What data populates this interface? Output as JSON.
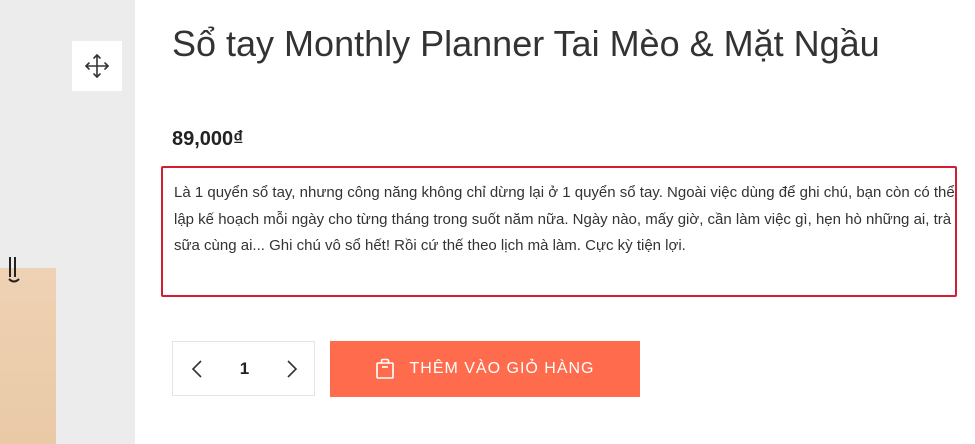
{
  "gallery": {
    "zoom_icon": "move-arrows-icon",
    "photo_alt": "product photo"
  },
  "product": {
    "title": "Sổ tay Monthly Planner Tai Mèo & Mặt Ngầu",
    "price": "89,000₫",
    "description": "Là 1 quyển sổ tay, nhưng công năng không chỉ dừng lại ở 1 quyển sổ tay. Ngoài việc dùng để ghi chú, bạn còn có thể lập kế hoạch mỗi ngày cho từng tháng trong suốt năm nữa. Ngày nào, mấy giờ, cần làm việc gì, hẹn hò những ai, trà sữa cùng ai... Ghi chú vô sổ hết! Rồi cứ thế theo lịch mà làm. Cực kỳ tiện lợi."
  },
  "quantity": {
    "value": "1",
    "decrease_icon": "chevron-left-icon",
    "increase_icon": "chevron-right-icon"
  },
  "cart": {
    "label": "THÊM VÀO GIỎ HÀNG",
    "icon": "shopping-bag-icon",
    "color": "#ff6c4d"
  },
  "highlight": {
    "border_color": "#d21d33"
  }
}
